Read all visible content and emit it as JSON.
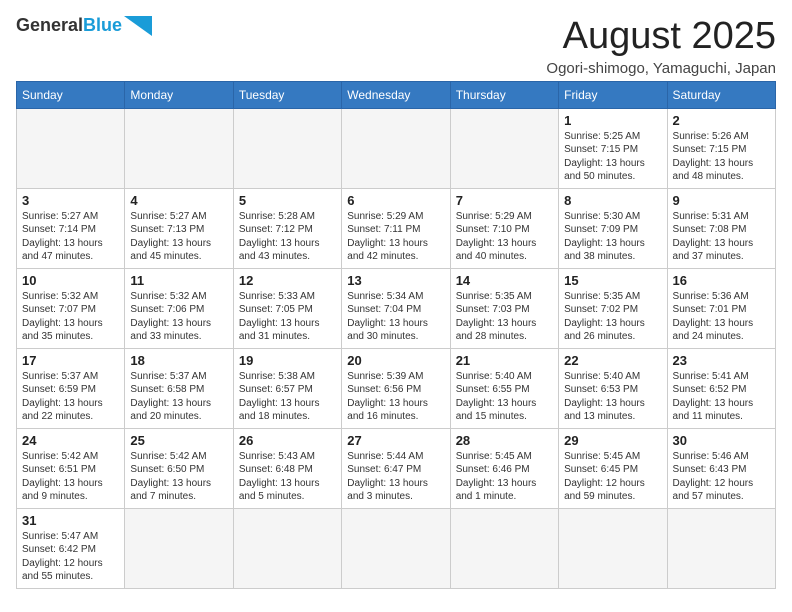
{
  "header": {
    "logo_general": "General",
    "logo_blue": "Blue",
    "month_title": "August 2025",
    "location": "Ogori-shimogo, Yamaguchi, Japan"
  },
  "weekdays": [
    "Sunday",
    "Monday",
    "Tuesday",
    "Wednesday",
    "Thursday",
    "Friday",
    "Saturday"
  ],
  "weeks": [
    [
      {
        "day": "",
        "info": ""
      },
      {
        "day": "",
        "info": ""
      },
      {
        "day": "",
        "info": ""
      },
      {
        "day": "",
        "info": ""
      },
      {
        "day": "",
        "info": ""
      },
      {
        "day": "1",
        "info": "Sunrise: 5:25 AM\nSunset: 7:15 PM\nDaylight: 13 hours and 50 minutes."
      },
      {
        "day": "2",
        "info": "Sunrise: 5:26 AM\nSunset: 7:15 PM\nDaylight: 13 hours and 48 minutes."
      }
    ],
    [
      {
        "day": "3",
        "info": "Sunrise: 5:27 AM\nSunset: 7:14 PM\nDaylight: 13 hours and 47 minutes."
      },
      {
        "day": "4",
        "info": "Sunrise: 5:27 AM\nSunset: 7:13 PM\nDaylight: 13 hours and 45 minutes."
      },
      {
        "day": "5",
        "info": "Sunrise: 5:28 AM\nSunset: 7:12 PM\nDaylight: 13 hours and 43 minutes."
      },
      {
        "day": "6",
        "info": "Sunrise: 5:29 AM\nSunset: 7:11 PM\nDaylight: 13 hours and 42 minutes."
      },
      {
        "day": "7",
        "info": "Sunrise: 5:29 AM\nSunset: 7:10 PM\nDaylight: 13 hours and 40 minutes."
      },
      {
        "day": "8",
        "info": "Sunrise: 5:30 AM\nSunset: 7:09 PM\nDaylight: 13 hours and 38 minutes."
      },
      {
        "day": "9",
        "info": "Sunrise: 5:31 AM\nSunset: 7:08 PM\nDaylight: 13 hours and 37 minutes."
      }
    ],
    [
      {
        "day": "10",
        "info": "Sunrise: 5:32 AM\nSunset: 7:07 PM\nDaylight: 13 hours and 35 minutes."
      },
      {
        "day": "11",
        "info": "Sunrise: 5:32 AM\nSunset: 7:06 PM\nDaylight: 13 hours and 33 minutes."
      },
      {
        "day": "12",
        "info": "Sunrise: 5:33 AM\nSunset: 7:05 PM\nDaylight: 13 hours and 31 minutes."
      },
      {
        "day": "13",
        "info": "Sunrise: 5:34 AM\nSunset: 7:04 PM\nDaylight: 13 hours and 30 minutes."
      },
      {
        "day": "14",
        "info": "Sunrise: 5:35 AM\nSunset: 7:03 PM\nDaylight: 13 hours and 28 minutes."
      },
      {
        "day": "15",
        "info": "Sunrise: 5:35 AM\nSunset: 7:02 PM\nDaylight: 13 hours and 26 minutes."
      },
      {
        "day": "16",
        "info": "Sunrise: 5:36 AM\nSunset: 7:01 PM\nDaylight: 13 hours and 24 minutes."
      }
    ],
    [
      {
        "day": "17",
        "info": "Sunrise: 5:37 AM\nSunset: 6:59 PM\nDaylight: 13 hours and 22 minutes."
      },
      {
        "day": "18",
        "info": "Sunrise: 5:37 AM\nSunset: 6:58 PM\nDaylight: 13 hours and 20 minutes."
      },
      {
        "day": "19",
        "info": "Sunrise: 5:38 AM\nSunset: 6:57 PM\nDaylight: 13 hours and 18 minutes."
      },
      {
        "day": "20",
        "info": "Sunrise: 5:39 AM\nSunset: 6:56 PM\nDaylight: 13 hours and 16 minutes."
      },
      {
        "day": "21",
        "info": "Sunrise: 5:40 AM\nSunset: 6:55 PM\nDaylight: 13 hours and 15 minutes."
      },
      {
        "day": "22",
        "info": "Sunrise: 5:40 AM\nSunset: 6:53 PM\nDaylight: 13 hours and 13 minutes."
      },
      {
        "day": "23",
        "info": "Sunrise: 5:41 AM\nSunset: 6:52 PM\nDaylight: 13 hours and 11 minutes."
      }
    ],
    [
      {
        "day": "24",
        "info": "Sunrise: 5:42 AM\nSunset: 6:51 PM\nDaylight: 13 hours and 9 minutes."
      },
      {
        "day": "25",
        "info": "Sunrise: 5:42 AM\nSunset: 6:50 PM\nDaylight: 13 hours and 7 minutes."
      },
      {
        "day": "26",
        "info": "Sunrise: 5:43 AM\nSunset: 6:48 PM\nDaylight: 13 hours and 5 minutes."
      },
      {
        "day": "27",
        "info": "Sunrise: 5:44 AM\nSunset: 6:47 PM\nDaylight: 13 hours and 3 minutes."
      },
      {
        "day": "28",
        "info": "Sunrise: 5:45 AM\nSunset: 6:46 PM\nDaylight: 13 hours and 1 minute."
      },
      {
        "day": "29",
        "info": "Sunrise: 5:45 AM\nSunset: 6:45 PM\nDaylight: 12 hours and 59 minutes."
      },
      {
        "day": "30",
        "info": "Sunrise: 5:46 AM\nSunset: 6:43 PM\nDaylight: 12 hours and 57 minutes."
      }
    ],
    [
      {
        "day": "31",
        "info": "Sunrise: 5:47 AM\nSunset: 6:42 PM\nDaylight: 12 hours and 55 minutes."
      },
      {
        "day": "",
        "info": ""
      },
      {
        "day": "",
        "info": ""
      },
      {
        "day": "",
        "info": ""
      },
      {
        "day": "",
        "info": ""
      },
      {
        "day": "",
        "info": ""
      },
      {
        "day": "",
        "info": ""
      }
    ]
  ]
}
